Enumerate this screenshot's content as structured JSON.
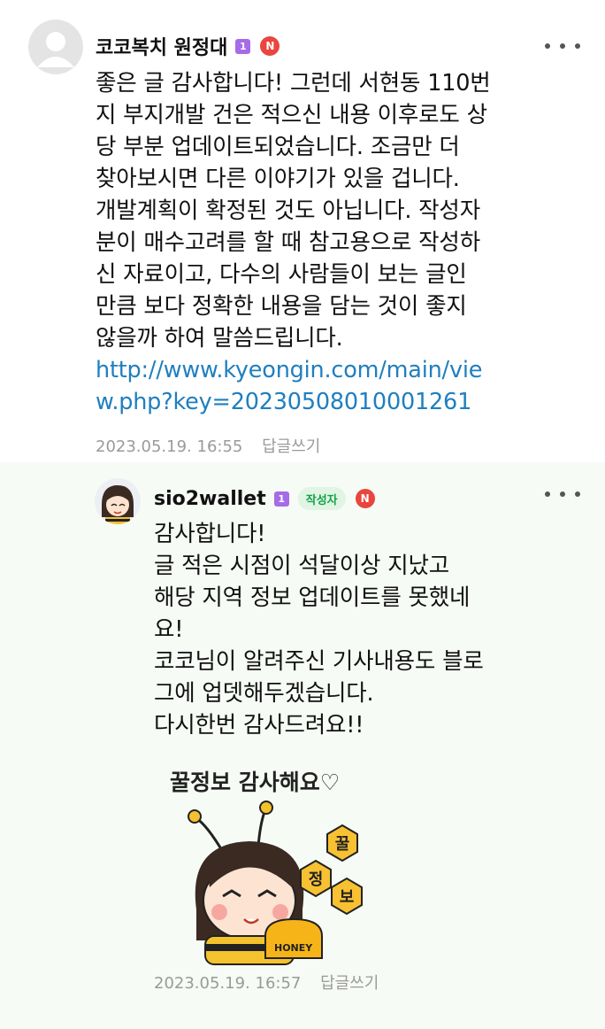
{
  "comments": [
    {
      "nickname": "코코복치 원정대",
      "grade_badge": "1",
      "new_badge": "N",
      "lines": [
        "좋은 글 감사합니다! 그런데 서현동 110번",
        "지 부지개발 건은 적으신 내용 이후로도 상",
        "당 부분 업데이트되었습니다. 조금만 더",
        "찾아보시면 다른 이야기가 있을 겁니다.",
        "개발계획이 확정된 것도 아닙니다. 작성자",
        "분이 매수고려를 할 때 참고용으로 작성하",
        "신 자료이고, 다수의 사람들이 보는 글인",
        "만큼 보다 정확한 내용을 담는 것이 좋지",
        "않을까 하여 말씀드립니다."
      ],
      "link_lines": [
        "http://www.kyeongin.com/main/vie",
        "w.php?key=20230508010001261"
      ],
      "timestamp": "2023.05.19. 16:55",
      "reply_label": "답글쓰기"
    },
    {
      "nickname": "sio2wallet",
      "grade_badge": "1",
      "writer_badge": "작성자",
      "new_badge": "N",
      "lines": [
        "감사합니다!",
        "글 적은 시점이 석달이상 지났고",
        "해당 지역 정보 업데이트를 못했네",
        "요!",
        "코코님이 알려주신 기사내용도 블로",
        "그에 업뎃해두겠습니다.",
        "다시한번 감사드려요!!"
      ],
      "sticker": {
        "caption": "꿀정보 감사해요♡",
        "jar_chars": [
          "꿀",
          "정",
          "보"
        ],
        "honey_label": "HONEY"
      },
      "timestamp": "2023.05.19. 16:57",
      "reply_label": "답글쓰기"
    }
  ],
  "icons": {
    "more": "more-dots-icon",
    "default_avatar": "default-avatar-icon",
    "profile_avatar": "bee-girl-avatar"
  },
  "colors": {
    "link": "#1f7fbf",
    "grade_badge": "#a66be6",
    "new_badge": "#e8463e",
    "writer_badge_bg": "#e1f5e4",
    "writer_badge_text": "#15a24a",
    "reply_bg": "#f6fbf5"
  }
}
